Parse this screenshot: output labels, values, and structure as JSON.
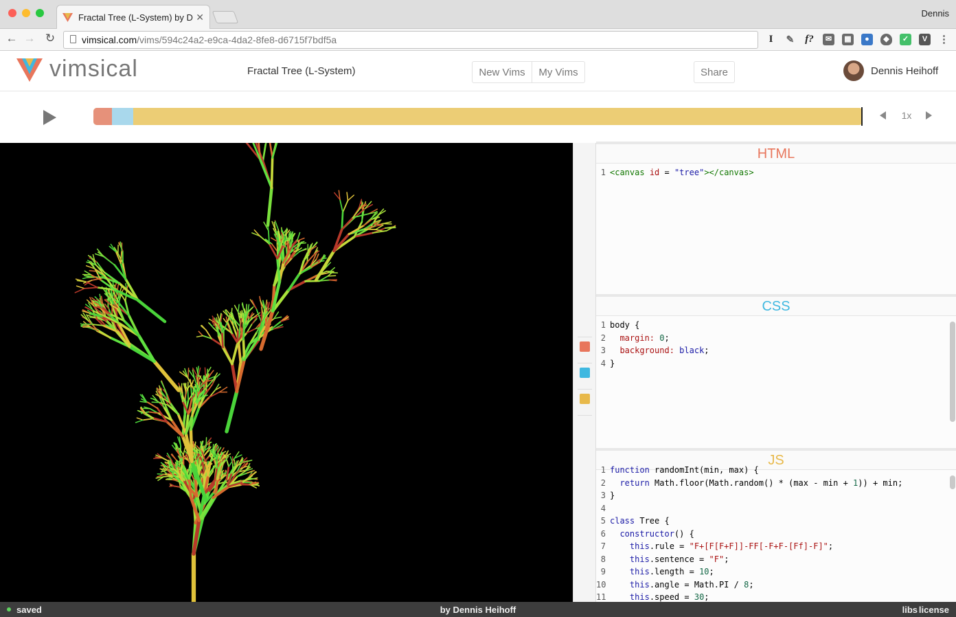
{
  "browser": {
    "tab_title": "Fractal Tree (L-System) by Dennis Heihoff",
    "profile": "Dennis",
    "url_domain": "vimsical.com",
    "url_path": "/vims/594c24a2-e9ca-4da2-8fe8-d6715f7bdf5a"
  },
  "app": {
    "logo": "vimsical",
    "vim_title": "Fractal Tree (L-System)",
    "new_vims": "New Vims",
    "my_vims": "My Vims",
    "share": "Share",
    "user": "Dennis Heihoff"
  },
  "player": {
    "speed": "1x",
    "progress": 1.0
  },
  "panels": {
    "html": {
      "title": "HTML",
      "color": "#e8765c"
    },
    "css": {
      "title": "CSS",
      "color": "#3fb8e0"
    },
    "js": {
      "title": "JS",
      "color": "#e8b94a"
    }
  },
  "colors": {
    "html": "#e6917a",
    "css": "#a9d8ec",
    "js": "#eccd75",
    "swatch_html": "#e8765c",
    "swatch_css": "#3fb8e0",
    "swatch_js": "#e8b94a"
  },
  "code": {
    "html": [
      "<canvas id = \"tree\"></canvas>"
    ],
    "css": [
      "body {",
      "  margin: 0;",
      "  background: black;",
      "}"
    ],
    "js": [
      "function randomInt(min, max) {",
      "  return Math.floor(Math.random() * (max - min + 1)) + min;",
      "}",
      "",
      "class Tree {",
      "  constructor() {",
      "    this.rule = \"F+[F[F+F]]-FF[-F+F-[Ff]-F]\";",
      "    this.sentence = \"F\";",
      "    this.length = 10;",
      "    this.angle = Math.PI / 8;",
      "    this.speed = 30;"
    ]
  },
  "status": {
    "saved": "saved",
    "author": "by Dennis Heihoff",
    "libs": "libs",
    "license": "license"
  }
}
